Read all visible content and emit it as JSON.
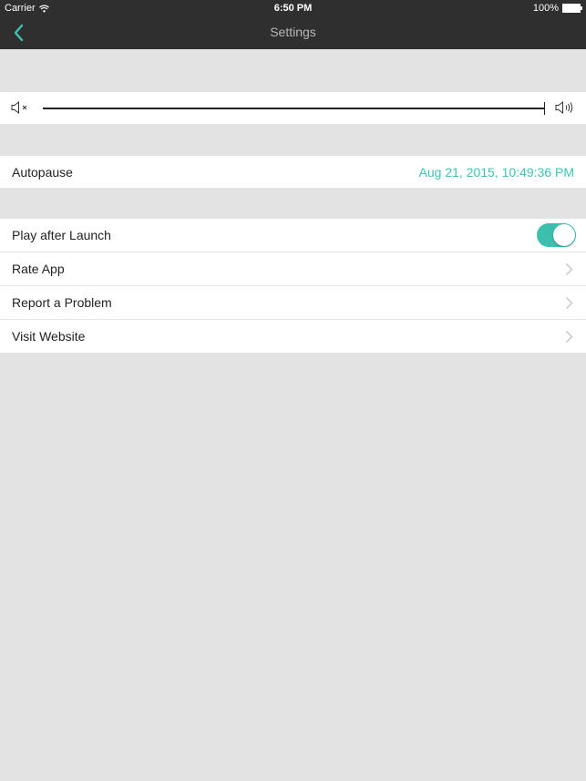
{
  "status_bar": {
    "carrier": "Carrier",
    "time": "6:50 PM",
    "battery": "100%"
  },
  "nav": {
    "title": "Settings",
    "back_icon": "chevron-left-icon"
  },
  "volume": {
    "min_icon": "speaker-mute-icon",
    "max_icon": "speaker-loud-icon",
    "level_percent": 100
  },
  "autopause": {
    "label": "Autopause",
    "value": "Aug 21, 2015, 10:49:36 PM"
  },
  "list": {
    "items": [
      {
        "label": "Play after Launch",
        "type": "toggle",
        "on": true
      },
      {
        "label": "Rate App",
        "type": "disclosure"
      },
      {
        "label": "Report a Problem",
        "type": "disclosure"
      },
      {
        "label": "Visit Website",
        "type": "disclosure"
      }
    ]
  },
  "colors": {
    "accent": "#3dbfae",
    "bar": "#2f2f2f",
    "background": "#e3e3e3"
  }
}
